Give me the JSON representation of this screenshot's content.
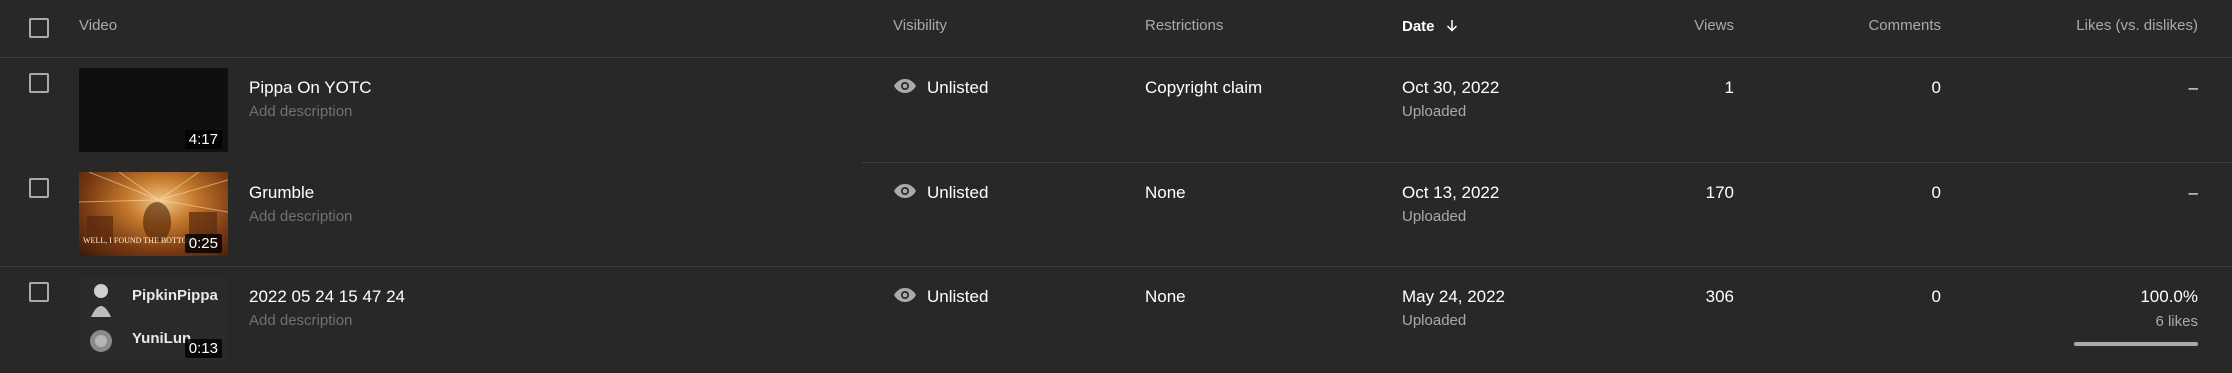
{
  "header": {
    "video": "Video",
    "visibility": "Visibility",
    "restrictions": "Restrictions",
    "date": "Date",
    "views": "Views",
    "comments": "Comments",
    "likes": "Likes (vs. dislikes)",
    "sort_icon": "arrow-down-icon"
  },
  "rows": [
    {
      "title": "Pippa On YOTC",
      "description": "Add description",
      "duration": "4:17",
      "visibility": "Unlisted",
      "restrictions": "Copyright claim",
      "date": "Oct 30, 2022",
      "date_status": "Uploaded",
      "views": "1",
      "comments": "0",
      "likes": "–"
    },
    {
      "title": "Grumble",
      "description": "Add description",
      "duration": "0:25",
      "visibility": "Unlisted",
      "restrictions": "None",
      "date": "Oct 13, 2022",
      "date_status": "Uploaded",
      "views": "170",
      "comments": "0",
      "likes": "–",
      "thumbnail_caption": "WELL, I FOUND THE BOTTOM"
    },
    {
      "title": "2022 05 24 15 47 24",
      "description": "Add description",
      "duration": "0:13",
      "visibility": "Unlisted",
      "restrictions": "None",
      "date": "May 24, 2022",
      "date_status": "Uploaded",
      "views": "306",
      "comments": "0",
      "likes": "100.0%",
      "likes_count": "6 likes",
      "likes_ratio": 1.0,
      "thumbnail_name_1": "PipkinPippa",
      "thumbnail_name_2": "YuniLun"
    }
  ],
  "colors": {
    "background": "#282828",
    "text": "#f1f1f1",
    "muted": "#aaaaaa",
    "divider": "#3d3d3d"
  }
}
